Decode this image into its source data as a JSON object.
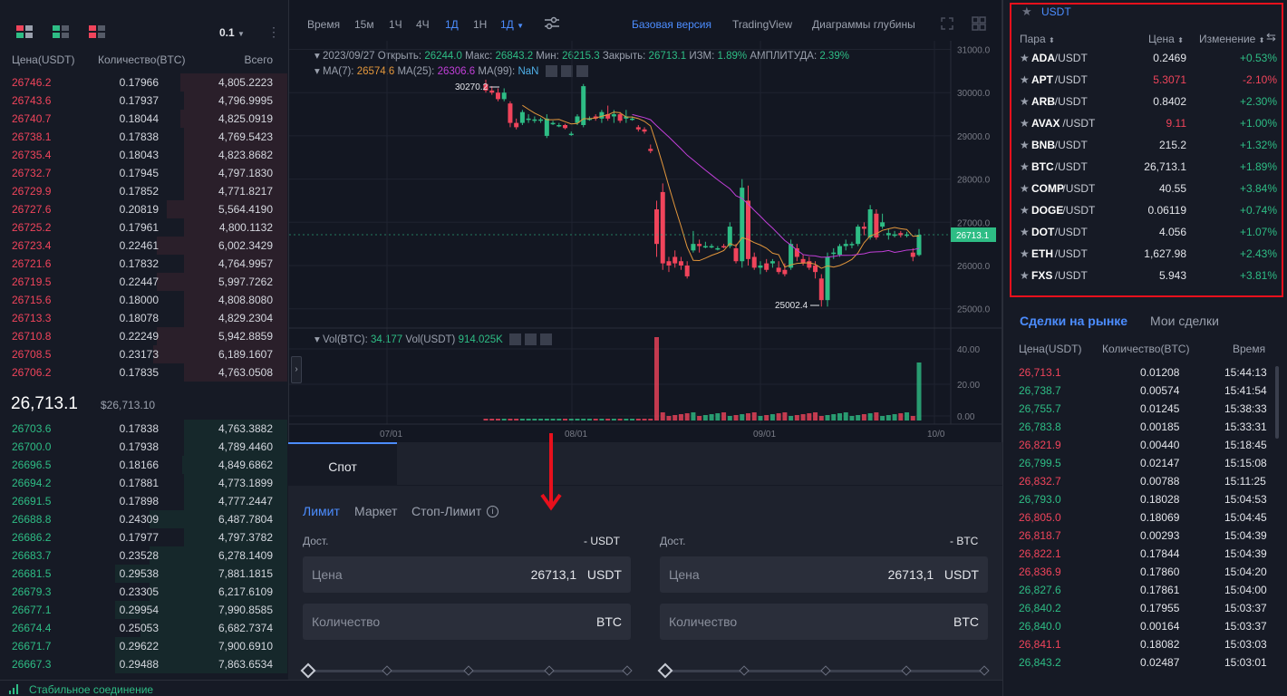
{
  "orderbook": {
    "precision": "0.1",
    "headers": {
      "price": "Цена(USDT)",
      "qty": "Количество(BTC)",
      "total": "Всего"
    },
    "asks": [
      {
        "price": "26746.2",
        "qty": "0.17966",
        "total": "4,805.2223",
        "depth": 0.62
      },
      {
        "price": "26743.6",
        "qty": "0.17937",
        "total": "4,796.9995",
        "depth": 0.6
      },
      {
        "price": "26740.7",
        "qty": "0.18044",
        "total": "4,825.0919",
        "depth": 0.62
      },
      {
        "price": "26738.1",
        "qty": "0.17838",
        "total": "4,769.5423",
        "depth": 0.6
      },
      {
        "price": "26735.4",
        "qty": "0.18043",
        "total": "4,823.8682",
        "depth": 0.6
      },
      {
        "price": "26732.7",
        "qty": "0.17945",
        "total": "4,797.1830",
        "depth": 0.6
      },
      {
        "price": "26729.9",
        "qty": "0.17852",
        "total": "4,771.8217",
        "depth": 0.6
      },
      {
        "price": "26727.6",
        "qty": "0.20819",
        "total": "5,564.4190",
        "depth": 0.7
      },
      {
        "price": "26725.2",
        "qty": "0.17961",
        "total": "4,800.1132",
        "depth": 0.6
      },
      {
        "price": "26723.4",
        "qty": "0.22461",
        "total": "6,002.3429",
        "depth": 0.76
      },
      {
        "price": "26721.6",
        "qty": "0.17832",
        "total": "4,764.9957",
        "depth": 0.6
      },
      {
        "price": "26719.5",
        "qty": "0.22447",
        "total": "5,997.7262",
        "depth": 0.76
      },
      {
        "price": "26715.6",
        "qty": "0.18000",
        "total": "4,808.8080",
        "depth": 0.6
      },
      {
        "price": "26713.3",
        "qty": "0.18078",
        "total": "4,829.2304",
        "depth": 0.6
      },
      {
        "price": "26710.8",
        "qty": "0.22249",
        "total": "5,942.8859",
        "depth": 0.76
      },
      {
        "price": "26708.5",
        "qty": "0.23173",
        "total": "6,189.1607",
        "depth": 0.78
      },
      {
        "price": "26706.2",
        "qty": "0.17835",
        "total": "4,763.0508",
        "depth": 0.6
      }
    ],
    "last_price": "26,713.1",
    "last_usd": "$26,713.10",
    "bids": [
      {
        "price": "26703.6",
        "qty": "0.17838",
        "total": "4,763.3882",
        "depth": 0.6
      },
      {
        "price": "26700.0",
        "qty": "0.17938",
        "total": "4,789.4460",
        "depth": 0.6
      },
      {
        "price": "26696.5",
        "qty": "0.18166",
        "total": "4,849.6862",
        "depth": 0.61
      },
      {
        "price": "26694.2",
        "qty": "0.17881",
        "total": "4,773.1899",
        "depth": 0.6
      },
      {
        "price": "26691.5",
        "qty": "0.17898",
        "total": "4,777.2447",
        "depth": 0.6
      },
      {
        "price": "26688.8",
        "qty": "0.24309",
        "total": "6,487.7804",
        "depth": 0.8
      },
      {
        "price": "26686.2",
        "qty": "0.17977",
        "total": "4,797.3782",
        "depth": 0.6
      },
      {
        "price": "26683.7",
        "qty": "0.23528",
        "total": "6,278.1409",
        "depth": 0.8
      },
      {
        "price": "26681.5",
        "qty": "0.29538",
        "total": "7,881.1815",
        "depth": 1.0
      },
      {
        "price": "26679.3",
        "qty": "0.23305",
        "total": "6,217.6109",
        "depth": 0.8
      },
      {
        "price": "26677.1",
        "qty": "0.29954",
        "total": "7,990.8585",
        "depth": 1.0
      },
      {
        "price": "26674.4",
        "qty": "0.25053",
        "total": "6,682.7374",
        "depth": 0.85
      },
      {
        "price": "26671.7",
        "qty": "0.29622",
        "total": "7,900.6910",
        "depth": 1.0
      },
      {
        "price": "26667.3",
        "qty": "0.29488",
        "total": "7,863.6534",
        "depth": 1.0
      }
    ]
  },
  "chart": {
    "toolbar": [
      "Время",
      "15м",
      "1Ч",
      "4Ч",
      "1Д",
      "1Н"
    ],
    "active_interval": "1Д",
    "dropdown_interval": "1Д",
    "views": {
      "basic": "Базовая версия",
      "tv": "TradingView",
      "depth": "Диаграммы глубины"
    },
    "ohlc": {
      "date": "2023/09/27",
      "open_label": "Открыть:",
      "open": "26244.0",
      "high_label": "Макс:",
      "high": "26843.2",
      "low_label": "Мин:",
      "low": "26215.3",
      "close_label": "Закрыть:",
      "close": "26713.1",
      "chg_label": "ИЗМ:",
      "chg": "1.89%",
      "amp_label": "АМПЛИТУДА:",
      "amp": "2.39%"
    },
    "ma": {
      "ma7_label": "MA(7):",
      "ma7": "26574.6",
      "ma25_label": "MA(25):",
      "ma25": "26306.6",
      "ma99_label": "MA(99):",
      "ma99": "NaN"
    },
    "vol": {
      "btc_label": "Vol(BTC):",
      "btc": "34.177",
      "usdt_label": "Vol(USDT)",
      "usdt": "914.025K"
    },
    "price_axis": [
      "31000.0",
      "30000.0",
      "29000.0",
      "28000.0",
      "27000.0",
      "26000.0",
      "25000.0"
    ],
    "vol_axis": [
      "40.00",
      "20.00",
      "0.00"
    ],
    "time_axis": [
      "07/01",
      "08/01",
      "09/01",
      "10/0"
    ],
    "current_price": "26713.1",
    "high_marker": "30270.2",
    "low_marker": "25002.4",
    "up_color": "#2ebd85",
    "down_color": "#f0445b"
  },
  "chart_data": {
    "type": "candlestick",
    "candles": [
      [
        30200,
        30300,
        30000,
        30050
      ],
      [
        30050,
        30150,
        29950,
        30000
      ],
      [
        30000,
        30100,
        29800,
        29850
      ],
      [
        29850,
        30100,
        29800,
        30000
      ],
      [
        29750,
        29800,
        29200,
        29300
      ],
      [
        29300,
        29400,
        29150,
        29200
      ],
      [
        29300,
        29600,
        29250,
        29550
      ],
      [
        29400,
        29500,
        29300,
        29400
      ],
      [
        29350,
        29450,
        29300,
        29380
      ],
      [
        29350,
        29420,
        29300,
        29380
      ],
      [
        29000,
        29500,
        28950,
        29400
      ],
      [
        29300,
        29350,
        29250,
        29300
      ],
      [
        29250,
        29300,
        29200,
        29250
      ],
      [
        29250,
        29280,
        29150,
        29180
      ],
      [
        29050,
        29100,
        29000,
        29050
      ],
      [
        29300,
        29500,
        29250,
        29450
      ],
      [
        29250,
        30200,
        29200,
        30150
      ],
      [
        29400,
        29450,
        29350,
        29400
      ],
      [
        29450,
        29500,
        29350,
        29400
      ],
      [
        29400,
        29600,
        29300,
        29550
      ],
      [
        29500,
        29700,
        29350,
        29400
      ],
      [
        29450,
        29600,
        29300,
        29500
      ],
      [
        29500,
        29550,
        29300,
        29350
      ],
      [
        29400,
        29600,
        29300,
        29450
      ],
      [
        29400,
        29450,
        29350,
        29400
      ],
      [
        29200,
        29250,
        29100,
        29150
      ],
      [
        29150,
        29200,
        29050,
        29100
      ],
      [
        28700,
        28800,
        28600,
        28650
      ],
      [
        27300,
        27500,
        26200,
        26500
      ],
      [
        27700,
        27900,
        25900,
        26050
      ],
      [
        26100,
        26200,
        25850,
        26000
      ],
      [
        26200,
        26350,
        25950,
        26050
      ],
      [
        26100,
        26200,
        25900,
        26000
      ],
      [
        26000,
        26100,
        25700,
        25750
      ],
      [
        26350,
        26800,
        26300,
        26500
      ],
      [
        26500,
        26600,
        26300,
        26450
      ],
      [
        26450,
        26550,
        26400,
        26450
      ],
      [
        26450,
        26500,
        26400,
        26450
      ],
      [
        26400,
        26450,
        26350,
        26400
      ],
      [
        26450,
        26500,
        26400,
        26420
      ],
      [
        26450,
        27000,
        26400,
        26900
      ],
      [
        26400,
        26500,
        26050,
        26100
      ],
      [
        26100,
        28000,
        25950,
        27800
      ],
      [
        27500,
        27850,
        26000,
        26150
      ],
      [
        26200,
        26300,
        25900,
        25950
      ],
      [
        25950,
        26100,
        25800,
        26000
      ],
      [
        26050,
        26150,
        25850,
        25900
      ],
      [
        26050,
        26150,
        25950,
        26100
      ],
      [
        25950,
        26100,
        25800,
        25850
      ],
      [
        25900,
        26050,
        25750,
        25800
      ],
      [
        25950,
        26600,
        25900,
        26500
      ],
      [
        26400,
        26500,
        26100,
        26200
      ],
      [
        26150,
        26250,
        26000,
        26050
      ],
      [
        26100,
        26200,
        25900,
        25950
      ],
      [
        26000,
        26100,
        25700,
        25850
      ],
      [
        25700,
        25800,
        25050,
        25200
      ],
      [
        25200,
        26300,
        25050,
        26200
      ],
      [
        26300,
        26400,
        26150,
        26300
      ],
      [
        26250,
        26500,
        26200,
        26450
      ],
      [
        26450,
        26600,
        26350,
        26500
      ],
      [
        26500,
        26550,
        26400,
        26500
      ],
      [
        26500,
        26950,
        26450,
        26900
      ],
      [
        26900,
        27000,
        26700,
        26850
      ],
      [
        26650,
        27400,
        26600,
        27300
      ],
      [
        27200,
        27300,
        26600,
        26650
      ],
      [
        26900,
        27200,
        26850,
        27000
      ],
      [
        26700,
        26850,
        26600,
        26750
      ],
      [
        26700,
        26800,
        26650,
        26720
      ],
      [
        26750,
        26800,
        26650,
        26700
      ],
      [
        26700,
        26780,
        26650,
        26720
      ],
      [
        26300,
        26400,
        26100,
        26200
      ],
      [
        26244,
        26843,
        26215,
        26713
      ]
    ],
    "ylim": [
      24700,
      31200
    ]
  },
  "spot": {
    "tab": "Спот",
    "order_types": [
      "Лимит",
      "Маркет",
      "Стоп-Лимит"
    ],
    "buy": {
      "avail_label": "Дост.",
      "avail_value": "- USDT",
      "price_label": "Цена",
      "price_value": "26713,1",
      "price_unit": "USDT",
      "qty_label": "Количество",
      "qty_unit": "BTC"
    },
    "sell": {
      "avail_label": "Дост.",
      "avail_value": "- BTC",
      "price_label": "Цена",
      "price_value": "26713,1",
      "price_unit": "USDT",
      "qty_label": "Количество",
      "qty_unit": "BTC"
    }
  },
  "market": {
    "tab": "USDT",
    "headers": {
      "pair": "Пара",
      "price": "Цена",
      "change": "Изменение"
    },
    "rows": [
      {
        "base": "ADA",
        "quote": "/USDT",
        "price": "0.2469",
        "change": "+0.53%",
        "up": true,
        "price_up": true
      },
      {
        "base": "APT",
        "quote": "/USDT",
        "price": "5.3071",
        "change": "-2.10%",
        "up": false,
        "price_up": false
      },
      {
        "base": "ARB",
        "quote": "/USDT",
        "price": "0.8402",
        "change": "+2.30%",
        "up": true,
        "price_up": true
      },
      {
        "base": "AVAX",
        "quote": "/USDT",
        "price": "9.11",
        "change": "+1.00%",
        "up": true,
        "price_up": false
      },
      {
        "base": "BNB",
        "quote": "/USDT",
        "price": "215.2",
        "change": "+1.32%",
        "up": true,
        "price_up": true
      },
      {
        "base": "BTC",
        "quote": "/USDT",
        "price": "26,713.1",
        "change": "+1.89%",
        "up": true,
        "price_up": true
      },
      {
        "base": "COMP",
        "quote": "/USDT",
        "price": "40.55",
        "change": "+3.84%",
        "up": true,
        "price_up": true
      },
      {
        "base": "DOGE",
        "quote": "/USDT",
        "price": "0.06119",
        "change": "+0.74%",
        "up": true,
        "price_up": true
      },
      {
        "base": "DOT",
        "quote": "/USDT",
        "price": "4.056",
        "change": "+1.07%",
        "up": true,
        "price_up": true
      },
      {
        "base": "ETH",
        "quote": "/USDT",
        "price": "1,627.98",
        "change": "+2.43%",
        "up": true,
        "price_up": true
      },
      {
        "base": "FXS",
        "quote": "/USDT",
        "price": "5.943",
        "change": "+3.81%",
        "up": true,
        "price_up": true
      }
    ]
  },
  "trades": {
    "tabs": [
      "Сделки на рынке",
      "Мои сделки"
    ],
    "headers": {
      "price": "Цена(USDT)",
      "qty": "Количество(BTC)",
      "time": "Время"
    },
    "rows": [
      {
        "price": "26,713.1",
        "qty": "0.01208",
        "time": "15:44:13",
        "up": false
      },
      {
        "price": "26,738.7",
        "qty": "0.00574",
        "time": "15:41:54",
        "up": true
      },
      {
        "price": "26,755.7",
        "qty": "0.01245",
        "time": "15:38:33",
        "up": true
      },
      {
        "price": "26,783.8",
        "qty": "0.00185",
        "time": "15:33:31",
        "up": true
      },
      {
        "price": "26,821.9",
        "qty": "0.00440",
        "time": "15:18:45",
        "up": false
      },
      {
        "price": "26,799.5",
        "qty": "0.02147",
        "time": "15:15:08",
        "up": true
      },
      {
        "price": "26,832.7",
        "qty": "0.00788",
        "time": "15:11:25",
        "up": false
      },
      {
        "price": "26,793.0",
        "qty": "0.18028",
        "time": "15:04:53",
        "up": true
      },
      {
        "price": "26,805.0",
        "qty": "0.18069",
        "time": "15:04:45",
        "up": false
      },
      {
        "price": "26,818.7",
        "qty": "0.00293",
        "time": "15:04:39",
        "up": false
      },
      {
        "price": "26,822.1",
        "qty": "0.17844",
        "time": "15:04:39",
        "up": false
      },
      {
        "price": "26,836.9",
        "qty": "0.17860",
        "time": "15:04:20",
        "up": false
      },
      {
        "price": "26,827.6",
        "qty": "0.17861",
        "time": "15:04:00",
        "up": true
      },
      {
        "price": "26,840.2",
        "qty": "0.17955",
        "time": "15:03:37",
        "up": true
      },
      {
        "price": "26,840.0",
        "qty": "0.00164",
        "time": "15:03:37",
        "up": true
      },
      {
        "price": "26,841.1",
        "qty": "0.18082",
        "time": "15:03:03",
        "up": false
      },
      {
        "price": "26,843.2",
        "qty": "0.02487",
        "time": "15:03:01",
        "up": true
      }
    ]
  },
  "status": {
    "text": "Стабильное соединение"
  }
}
